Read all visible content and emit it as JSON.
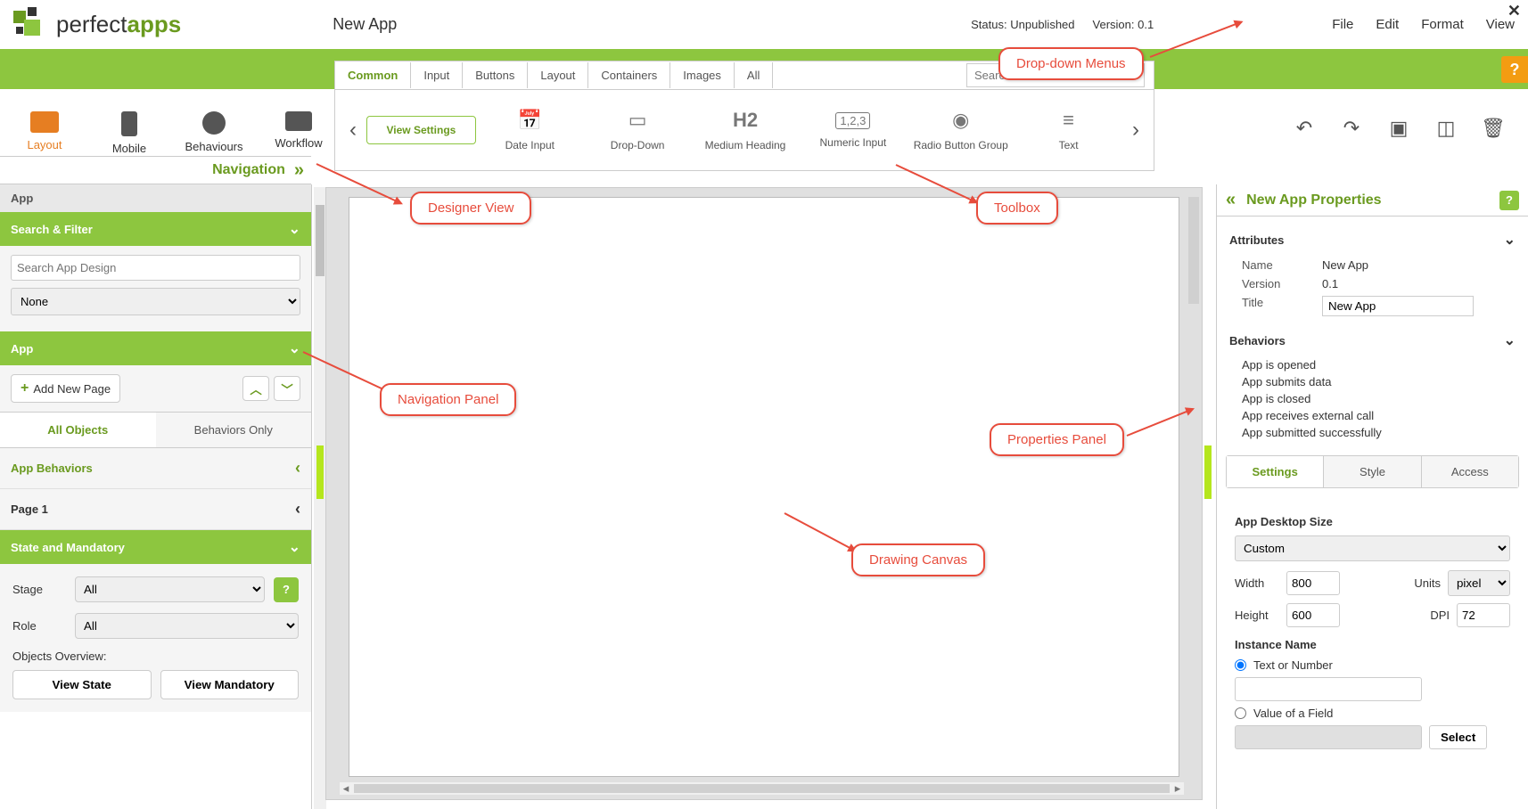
{
  "header": {
    "logoText1": "perfect",
    "logoText2": "apps",
    "appTitle": "New App",
    "statusLabel": "Status:",
    "statusValue": "Unpublished",
    "versionLabel": "Version:",
    "versionValue": "0.1",
    "menus": [
      "File",
      "Edit",
      "Format",
      "View"
    ]
  },
  "modes": [
    "Layout",
    "Mobile",
    "Behaviours",
    "Workflow"
  ],
  "toolbox": {
    "tabs": [
      "Common",
      "Input",
      "Buttons",
      "Layout",
      "Containers",
      "Images",
      "All"
    ],
    "searchPlaceholder": "Search Tools",
    "items": [
      {
        "label": "View Settings"
      },
      {
        "label": "Date Input"
      },
      {
        "label": "Drop-Down"
      },
      {
        "label": "Medium Heading"
      },
      {
        "label": "Numeric Input"
      },
      {
        "label": "Radio Button Group"
      },
      {
        "label": "Text"
      }
    ]
  },
  "nav": {
    "title": "Navigation",
    "appSection": "App",
    "searchFilter": "Search & Filter",
    "searchPlaceholder": "Search App Design",
    "filterNone": "None",
    "appSection2": "App",
    "addPage": "Add New Page",
    "tabAll": "All Objects",
    "tabBehaviors": "Behaviors Only",
    "appBehaviors": "App Behaviors",
    "page1": "Page 1",
    "stateMandatory": "State and Mandatory",
    "stageLabel": "Stage",
    "stageValue": "All",
    "roleLabel": "Role",
    "roleValue": "All",
    "overview": "Objects Overview:",
    "viewState": "View State",
    "viewMandatory": "View Mandatory"
  },
  "props": {
    "title": "New App Properties",
    "attributes": "Attributes",
    "nameLabel": "Name",
    "nameValue": "New App",
    "versionLabel": "Version",
    "versionValue": "0.1",
    "titleLabel": "Title",
    "titleValue": "New App",
    "behaviors": "Behaviors",
    "behaviorList": [
      "App is opened",
      "App submits data",
      "App is closed",
      "App receives external call",
      "App submitted successfully"
    ],
    "tabs": [
      "Settings",
      "Style",
      "Access"
    ],
    "desktopSize": "App Desktop Size",
    "sizeMode": "Custom",
    "widthLabel": "Width",
    "widthValue": "800",
    "heightLabel": "Height",
    "heightValue": "600",
    "unitsLabel": "Units",
    "unitsValue": "pixel",
    "dpiLabel": "DPI",
    "dpiValue": "72",
    "instanceName": "Instance Name",
    "radioText": "Text or Number",
    "radioField": "Value of a Field",
    "selectBtn": "Select"
  },
  "annotations": {
    "dropdown": "Drop-down Menus",
    "designer": "Designer View",
    "toolbox": "Toolbox",
    "navpanel": "Navigation Panel",
    "propspanel": "Properties Panel",
    "canvas": "Drawing Canvas"
  }
}
